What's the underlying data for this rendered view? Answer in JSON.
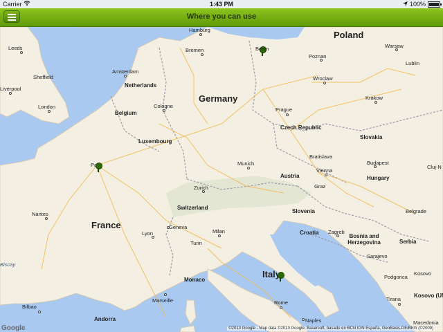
{
  "status_bar": {
    "carrier": "Carrier",
    "time": "1:43 PM",
    "battery": "100%"
  },
  "navbar": {
    "title": "Where you can use"
  },
  "map": {
    "attribution": "©2013 Google - Map data ©2013 Google, Basarsoft, basado en BCN IGN España, GeoBasis-DE/BKG (©2009)",
    "logo": "Google",
    "country_labels": [
      "Poland",
      "Germany",
      "France",
      "Italy"
    ],
    "region_labels": [
      "Netherlands",
      "Belgium",
      "Luxembourg",
      "Czech Republic",
      "Slovakia",
      "Austria",
      "Hungary",
      "Switzerland",
      "Slovenia",
      "Croatia",
      "Bosnia and Herzegovina",
      "Serbia",
      "Monaco",
      "Andorra"
    ],
    "city_labels": [
      "Leeds",
      "Liverpool",
      "Sheffield",
      "London",
      "Hamburg",
      "Bremen",
      "Amsterdam",
      "Cologne",
      "Prague",
      "Warsaw",
      "Poznan",
      "Lublin",
      "Wroclaw",
      "Krakow",
      "Munich",
      "Bratislava",
      "Vienna",
      "Budapest",
      "Graz",
      "Zurich",
      "Zagreb",
      "Paris",
      "Nantes",
      "Lyon",
      "Geneva",
      "Milan",
      "Turin",
      "Marseille",
      "Bilbao",
      "Rome",
      "Naples",
      "Tirana",
      "Sarajevo",
      "Podgorica",
      "Belgrade",
      "Kosovo",
      "Kosovo (UNMIK)",
      "Cluj-N",
      "Macedonia"
    ],
    "sea_labels": [
      "Biscay"
    ],
    "pins": [
      "Berlin",
      "Paris",
      "Italy"
    ]
  }
}
